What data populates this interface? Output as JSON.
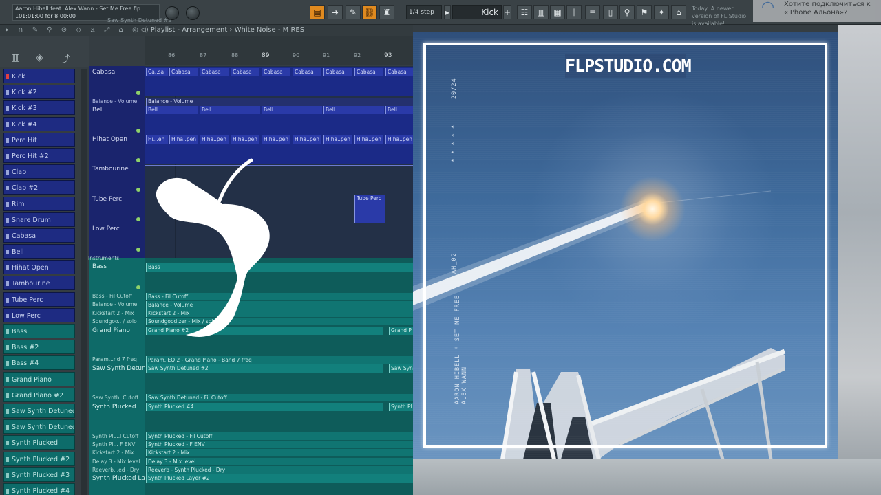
{
  "topbar": {
    "song_title": "Aaron Hibell feat. Alex Wann - Set Me Free.flp",
    "song_time": "101:01:00 for 8:00:00",
    "hint": "Saw Synth Detuned #2",
    "step": "1/4 step",
    "pattern": "Kick",
    "new_version": "Today: A newer version of FL Studio is available!",
    "wifi_prompt": "Хотите подключиться к «iPhone Альона»?"
  },
  "playlist": {
    "header": "Playlist - Arrangement",
    "breadcrumb": "White Noise - M RES",
    "ruler_bars": [
      "86",
      "87",
      "88",
      "89",
      "90",
      "91",
      "92",
      "93"
    ]
  },
  "picker": {
    "items": [
      "Kick",
      "Kick #2",
      "Kick #3",
      "Kick #4",
      "Perc Hit",
      "Perc Hit #2",
      "Clap",
      "Clap #2",
      "Rim",
      "Snare Drum",
      "Cabasa",
      "Bell",
      "Hihat Open",
      "Tambourine",
      "Tube Perc",
      "Low Perc",
      "Bass",
      "Bass #2",
      "Bass #4",
      "Grand Piano",
      "Grand Piano #2",
      "Saw Synth Detuned",
      "Saw Synth Detuned #2",
      "Synth Plucked",
      "Synth Plucked #2",
      "Synth Plucked #3",
      "Synth Plucked #4"
    ]
  },
  "tracks": {
    "cabasa": "Cabasa",
    "balance_volume": "Balance - Volume",
    "bell": "Bell",
    "hihat_open": "Hihat Open",
    "tambourine": "Tambourine",
    "tube_perc": "Tube Perc",
    "low_perc": "Low Perc",
    "instruments": "Instruments",
    "bass": "Bass",
    "bass_fil": "Bass - Fil Cutoff",
    "balance_vol2": "Balance - Volume",
    "kickstart": "Kickstart 2 - Mix",
    "soundgoo": "Soundgoo.. / solo",
    "grand_piano": "Grand Piano",
    "param": "Param...nd 7 freq",
    "saw_synth": "Saw Synth Detuned",
    "saw_cutoff": "Saw Synth..Cutoff",
    "synth_plucked": "Synth Plucked",
    "sp_cutoff": "Synth Plu..l Cutoff",
    "sp_fenv": "Synth Pl... F ENV",
    "kickstart2": "Kickstart 2 - Mix",
    "delay": "Delay 3 - Mix level",
    "reverb": "Reeverb...ed - Dry",
    "sp_layer": "Synth Plucked Layer"
  },
  "clips": {
    "cabasa_short": "Ca..sa",
    "cabasa": "Cabasa",
    "balance": "Balance - Volume",
    "bell": "Bell",
    "hihat_short": "Hi...en",
    "hihat": "Hiha..pen",
    "tube_perc": "Tube Perc",
    "bass": "Bass",
    "bass_fil": "Bass - Fil Cutoff",
    "balance2": "Balance - Volume",
    "kickstart": "Kickstart 2 - Mix",
    "soundgoo": "Soundgoodizer - Mix / solo",
    "grand_piano": "Grand Piano #2",
    "grand_piano_short": "Grand P",
    "param": "Param. EQ 2 - Grand Piano - Band 7 freq",
    "saw": "Saw Synth Detuned #2",
    "saw_short": "Saw Syn",
    "saw_cutoff": "Saw Synth Detuned - Fil Cutoff",
    "sp4": "Synth Plucked #4",
    "sp_short": "Synth Pl",
    "sp_cutoff": "Synth Plucked - Fil Cutoff",
    "sp_fenv": "Synth Plucked - F ENV",
    "kickstart2": "Kickstart 2 - Mix",
    "delay": "Delay 3 - Mix level",
    "reverb": "Reeverb - Synth Plucked - Dry",
    "layer": "Synth Plucked Layer #2",
    "layer_right": "Synth Plucked Layer #2"
  },
  "cover": {
    "brand": "FLPSTUDIO.COM",
    "code": "20/24",
    "stars": "*  *  *  *  *",
    "catalog": "AH_02",
    "title_line": "AARON HIBELL * SET ME FREE",
    "artist2": "ALEX WANN"
  },
  "colors": {
    "accent": "#e08a1f",
    "drum_track": "#1e2b82",
    "synth_track": "#0d6c6a"
  }
}
